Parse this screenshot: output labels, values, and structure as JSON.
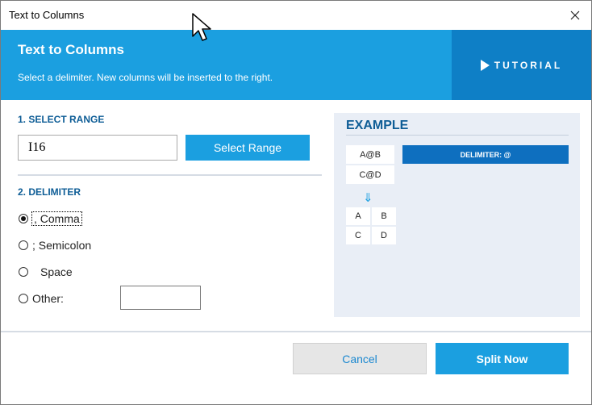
{
  "window": {
    "title": "Text to Columns"
  },
  "banner": {
    "heading": "Text to Columns",
    "subtitle": "Select a delimiter. New columns will be inserted to the right.",
    "tutorial_label": "TUTORIAL",
    "colors": {
      "banner": "#1b9fe0",
      "tutorial_bg": "#0e7fc6"
    }
  },
  "select_range": {
    "heading": "1. SELECT RANGE",
    "value": "I16",
    "button_label": "Select Range"
  },
  "delimiter": {
    "heading": "2. DELIMITER",
    "options": [
      {
        "label": ", Comma",
        "checked": true
      },
      {
        "label": "; Semicolon",
        "checked": false
      },
      {
        "label": "Space",
        "checked": false
      },
      {
        "label": "Other:",
        "checked": false
      }
    ],
    "other_value": ""
  },
  "example": {
    "title": "EXAMPLE",
    "source_cells": [
      "A@B",
      "C@D"
    ],
    "delimiter_label": "DELIMITER: @",
    "arrow": "⇓",
    "result_cells": [
      [
        "A",
        "B"
      ],
      [
        "C",
        "D"
      ]
    ]
  },
  "footer": {
    "cancel_label": "Cancel",
    "split_label": "Split Now"
  },
  "icons": [
    "close-icon",
    "play-icon",
    "mouse-cursor-icon",
    "down-arrow-icon"
  ]
}
